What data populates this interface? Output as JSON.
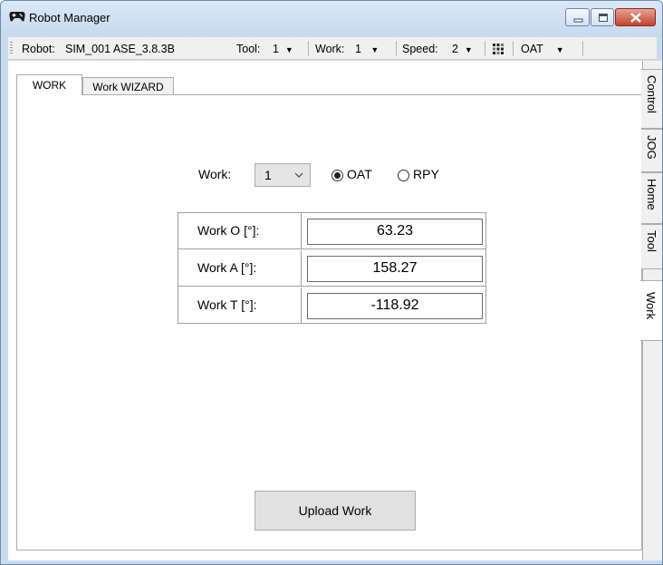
{
  "window": {
    "title": "Robot Manager",
    "icon": "gamepad-icon"
  },
  "toolbar": {
    "robot_label": "Robot:",
    "robot_value": "SIM_001 ASE_3.8.3B",
    "tool_label": "Tool:",
    "tool_value": "1",
    "work_label": "Work:",
    "work_value": "1",
    "speed_label": "Speed:",
    "speed_value": "2",
    "coord_icon": "coordinate-grid-icon",
    "mode_value": "OAT",
    "caret": "▼"
  },
  "tabs": [
    {
      "label": "WORK",
      "active": true
    },
    {
      "label": "Work WIZARD",
      "active": false
    }
  ],
  "side_tabs": [
    {
      "label": "Control",
      "active": false
    },
    {
      "label": "JOG",
      "active": false
    },
    {
      "label": "Home",
      "active": false
    },
    {
      "label": "Tool",
      "active": false
    },
    {
      "label": "Work",
      "active": true
    }
  ],
  "form": {
    "work_label": "Work:",
    "work_selected": "1",
    "orientation_options": [
      {
        "label": "OAT",
        "checked": true
      },
      {
        "label": "RPY",
        "checked": false
      }
    ],
    "rows": [
      {
        "label": "Work O [°]:",
        "value": "63.23"
      },
      {
        "label": "Work A [°]:",
        "value": "158.27"
      },
      {
        "label": "Work T [°]:",
        "value": "-118.92"
      }
    ],
    "upload_label": "Upload Work"
  },
  "colors": {
    "window_frame": "#c9dcef",
    "close_button": "#c7422d",
    "button_face": "#e1e1e1"
  }
}
